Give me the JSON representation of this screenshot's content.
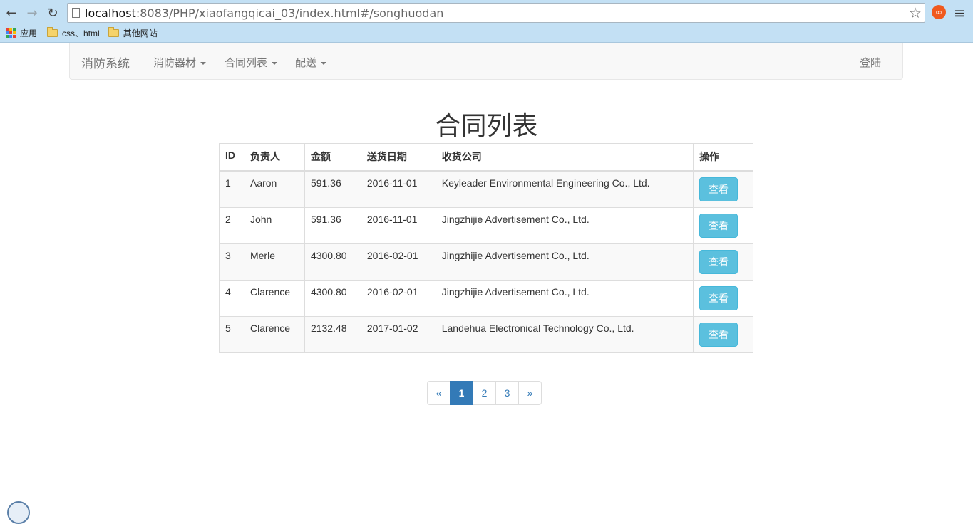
{
  "browser": {
    "url_host": "localhost",
    "url_rest": ":8083/PHP/xiaofangqicai_03/index.html#/songhuodan",
    "bookmarks": [
      "应用",
      "css、html",
      "其他网站"
    ]
  },
  "navbar": {
    "brand": "消防系统",
    "items": [
      {
        "label": "消防器材"
      },
      {
        "label": "合同列表"
      },
      {
        "label": "配送"
      }
    ],
    "login": "登陆"
  },
  "page": {
    "title": "合同列表"
  },
  "table": {
    "headers": [
      "ID",
      "负责人",
      "金额",
      "送货日期",
      "收货公司",
      "操作"
    ],
    "rows": [
      {
        "id": "1",
        "owner": "Aaron",
        "amount": "591.36",
        "date": "2016-11-01",
        "company": "Keyleader Environmental Engineering Co., Ltd.",
        "action": "查看"
      },
      {
        "id": "2",
        "owner": "John",
        "amount": "591.36",
        "date": "2016-11-01",
        "company": "Jingzhijie Advertisement Co., Ltd.",
        "action": "查看"
      },
      {
        "id": "3",
        "owner": "Merle",
        "amount": "4300.80",
        "date": "2016-02-01",
        "company": "Jingzhijie Advertisement Co., Ltd.",
        "action": "查看"
      },
      {
        "id": "4",
        "owner": "Clarence",
        "amount": "4300.80",
        "date": "2016-02-01",
        "company": "Jingzhijie Advertisement Co., Ltd.",
        "action": "查看"
      },
      {
        "id": "5",
        "owner": "Clarence",
        "amount": "2132.48",
        "date": "2017-01-02",
        "company": "Landehua Electronical Technology Co., Ltd.",
        "action": "查看"
      }
    ]
  },
  "pagination": {
    "prev": "«",
    "pages": [
      "1",
      "2",
      "3"
    ],
    "active": "1",
    "next": "»"
  },
  "colors": {
    "accent": "#337ab7",
    "info_button": "#5bc0de"
  }
}
